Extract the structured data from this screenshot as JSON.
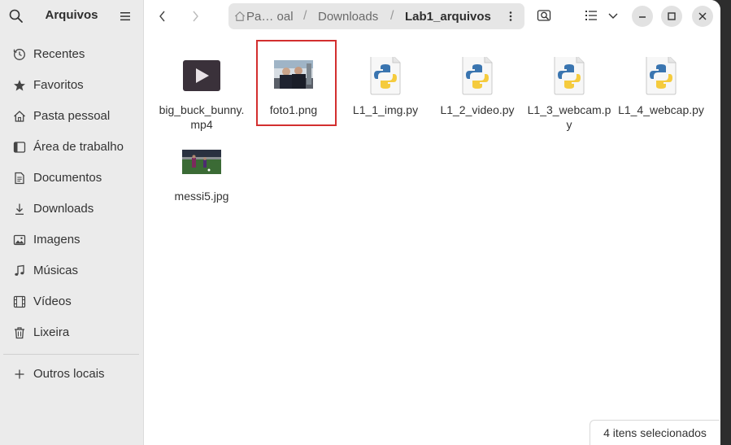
{
  "sidebar": {
    "title": "Arquivos",
    "items": [
      {
        "label": "Recentes",
        "icon": "clock-icon"
      },
      {
        "label": "Favoritos",
        "icon": "star-icon"
      },
      {
        "label": "Pasta pessoal",
        "icon": "home-icon"
      },
      {
        "label": "Área de trabalho",
        "icon": "desktop-icon"
      },
      {
        "label": "Documentos",
        "icon": "document-icon"
      },
      {
        "label": "Downloads",
        "icon": "download-icon"
      },
      {
        "label": "Imagens",
        "icon": "image-icon"
      },
      {
        "label": "Músicas",
        "icon": "music-icon"
      },
      {
        "label": "Vídeos",
        "icon": "video-icon"
      },
      {
        "label": "Lixeira",
        "icon": "trash-icon"
      }
    ],
    "other_locations": "Outros locais"
  },
  "pathbar": {
    "home": "Pa… oal",
    "downloads": "Downloads",
    "current": "Lab1_arquivos",
    "separator": "/"
  },
  "files": [
    {
      "name": "big_buck_bunny.mp4",
      "type": "video"
    },
    {
      "name": "foto1.png",
      "type": "image"
    },
    {
      "name": "L1_1_img.py",
      "type": "python"
    },
    {
      "name": "L1_2_video.py",
      "type": "python"
    },
    {
      "name": "L1_3_webcam.py",
      "type": "python"
    },
    {
      "name": "L1_4_webcap.py",
      "type": "python"
    },
    {
      "name": "messi5.jpg",
      "type": "image"
    }
  ],
  "status": "4 itens selecionados",
  "colors": {
    "highlight": "#d32f2f",
    "python_blue": "#3a75b0",
    "python_yellow": "#f5cb3d"
  }
}
